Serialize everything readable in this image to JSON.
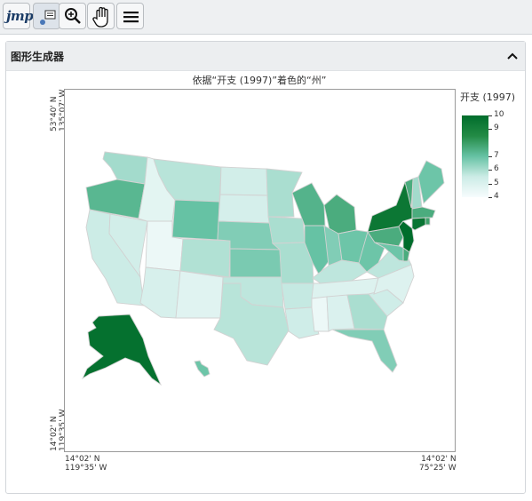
{
  "toolbar": {
    "jmp_label": "jmp",
    "buttons": [
      {
        "name": "jmp-logo-button",
        "icon": "jmp-logo-icon"
      },
      {
        "name": "selection-tool-button",
        "icon": "selection-icon"
      },
      {
        "name": "zoom-tool-button",
        "icon": "magnifier-plus-icon"
      },
      {
        "name": "hand-tool-button",
        "icon": "hand-icon"
      },
      {
        "name": "menu-button",
        "icon": "hamburger-menu-icon"
      }
    ]
  },
  "panel": {
    "title": "图形生成器",
    "collapse_icon": "chevron-up-icon"
  },
  "chart_data": {
    "type": "map",
    "title": "依据“开支 (1997)”着色的“州”",
    "legend": {
      "title": "开支 (1997)",
      "ticks": [
        "10",
        "9",
        "7",
        "6",
        "5",
        "4"
      ],
      "min": 4,
      "max": 10,
      "colors": [
        "#f7fcfd",
        "#ccece6",
        "#66c2a4",
        "#238b45",
        "#006d2c"
      ]
    },
    "y_tick_labels": [
      {
        "lines": [
          "53°40' N",
          "135°07' W"
        ]
      },
      {
        "lines": [
          "14°02' N",
          "119°35' W"
        ]
      }
    ],
    "x_tick_labels": [
      {
        "lines": [
          "14°02' N",
          "119°35' W"
        ]
      },
      {
        "lines": [
          "14°02' N",
          "75°25' W"
        ]
      }
    ],
    "states": [
      {
        "name": "WA",
        "value": 6.1
      },
      {
        "name": "OR",
        "value": 7.3
      },
      {
        "name": "CA",
        "value": 5.5
      },
      {
        "name": "NV",
        "value": 5.3
      },
      {
        "name": "ID",
        "value": 4.7
      },
      {
        "name": "MT",
        "value": 5.8
      },
      {
        "name": "WY",
        "value": 7.0
      },
      {
        "name": "UT",
        "value": 4.4
      },
      {
        "name": "CO",
        "value": 5.9
      },
      {
        "name": "AZ",
        "value": 5.1
      },
      {
        "name": "NM",
        "value": 4.8
      },
      {
        "name": "ND",
        "value": 5.3
      },
      {
        "name": "SD",
        "value": 5.2
      },
      {
        "name": "NE",
        "value": 6.6
      },
      {
        "name": "KS",
        "value": 6.7
      },
      {
        "name": "OK",
        "value": 5.7
      },
      {
        "name": "TX",
        "value": 5.8
      },
      {
        "name": "MN",
        "value": 6.0
      },
      {
        "name": "IA",
        "value": 6.0
      },
      {
        "name": "MO",
        "value": 6.0
      },
      {
        "name": "AR",
        "value": 5.6
      },
      {
        "name": "LA",
        "value": 5.4
      },
      {
        "name": "WI",
        "value": 7.4
      },
      {
        "name": "IL",
        "value": 7.0
      },
      {
        "name": "MI",
        "value": 7.6
      },
      {
        "name": "IN",
        "value": 6.6
      },
      {
        "name": "OH",
        "value": 6.9
      },
      {
        "name": "KY",
        "value": 5.7
      },
      {
        "name": "TN",
        "value": 4.9
      },
      {
        "name": "MS",
        "value": 4.4
      },
      {
        "name": "AL",
        "value": 5.0
      },
      {
        "name": "GA",
        "value": 6.0
      },
      {
        "name": "FL",
        "value": 6.6
      },
      {
        "name": "SC",
        "value": 5.4
      },
      {
        "name": "NC",
        "value": 4.9
      },
      {
        "name": "VA",
        "value": 5.7
      },
      {
        "name": "WV",
        "value": 6.9
      },
      {
        "name": "PA",
        "value": 7.6
      },
      {
        "name": "NY",
        "value": 9.5
      },
      {
        "name": "VT",
        "value": 7.6
      },
      {
        "name": "NH",
        "value": 6.1
      },
      {
        "name": "ME",
        "value": 6.9
      },
      {
        "name": "MA",
        "value": 7.6
      },
      {
        "name": "RI",
        "value": 7.9
      },
      {
        "name": "CT",
        "value": 9.6
      },
      {
        "name": "NJ",
        "value": 10.0
      },
      {
        "name": "DE",
        "value": 7.6
      },
      {
        "name": "MD",
        "value": 6.9
      },
      {
        "name": "AK",
        "value": 9.8
      },
      {
        "name": "HI",
        "value": 6.9
      }
    ]
  }
}
